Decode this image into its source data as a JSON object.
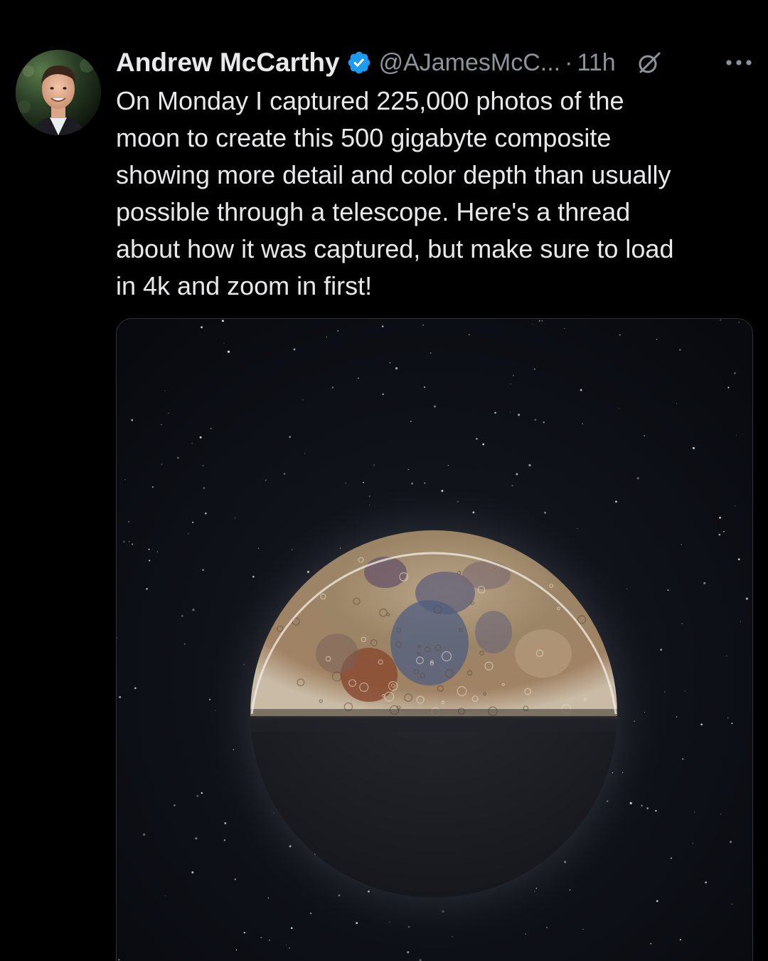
{
  "tweet": {
    "author_name": "Andrew McCarthy",
    "handle": "@AJamesMcC...",
    "separator": "·",
    "time": "11h",
    "text": "On Monday I captured 225,000 photos of the\nmoon to create this 500 gigabyte composite\nshowing more detail and color depth than usually\npossible through a telescope. Here's a thread\nabout how it was captured, but make sure to load\nin 4k and zoom in first!",
    "verified": true
  },
  "icons": {
    "verified": "verified-badge-icon",
    "grok": "grok-icon",
    "more": "more-options-icon"
  },
  "colors": {
    "background": "#000000",
    "text": "#e7e9ea",
    "secondary_text": "#8b949b",
    "verified_blue": "#1d9bf0"
  }
}
